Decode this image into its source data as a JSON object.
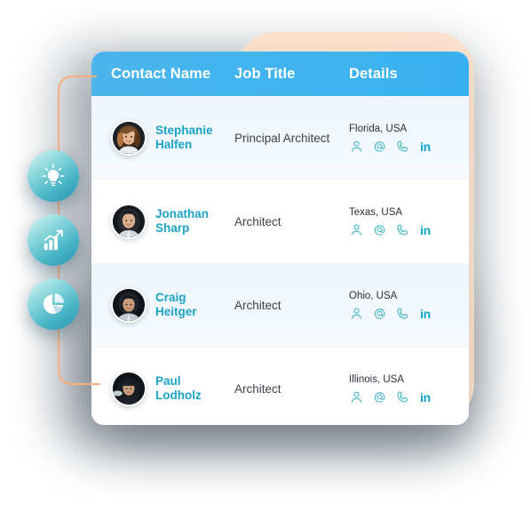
{
  "card": {
    "columns": [
      {
        "key": "name",
        "label": "Contact Name"
      },
      {
        "key": "job",
        "label": "Job Title"
      },
      {
        "key": "details",
        "label": "Details"
      }
    ],
    "header_bg": "#40b3ef",
    "name_color": "#1ba3c6",
    "icon_color": "#3fb6c4",
    "linkedin_color": "#0aa5c9",
    "rows": [
      {
        "name": "Stephanie Halfen",
        "job": "Principal Architect",
        "location": "Florida, USA",
        "avatar_alt": "avatar-stephanie-halfen"
      },
      {
        "name": "Jonathan Sharp",
        "job": "Architect",
        "location": "Texas, USA",
        "avatar_alt": "avatar-jonathan-sharp"
      },
      {
        "name": "Craig Heitger",
        "job": "Architect",
        "location": "Ohio, USA",
        "avatar_alt": "avatar-craig-heitger"
      },
      {
        "name": "Paul Lodholz",
        "job": "Architect",
        "location": "Illinois, USA",
        "avatar_alt": "avatar-paul-lodholz"
      }
    ],
    "detail_icons": [
      {
        "name": "contact-person-icon",
        "title": "Contact"
      },
      {
        "name": "email-icon",
        "title": "Email"
      },
      {
        "name": "phone-icon",
        "title": "Phone"
      },
      {
        "name": "linkedin-icon",
        "title": "LinkedIn",
        "label": "in"
      }
    ]
  },
  "badges": [
    {
      "name": "lightbulb-icon",
      "title": "Insights"
    },
    {
      "name": "bar-chart-icon",
      "title": "Growth"
    },
    {
      "name": "pie-chart-icon",
      "title": "Analytics"
    }
  ],
  "decor": {
    "connector_color": "#f2b183",
    "peach_panel_color": "#fae0cc"
  }
}
